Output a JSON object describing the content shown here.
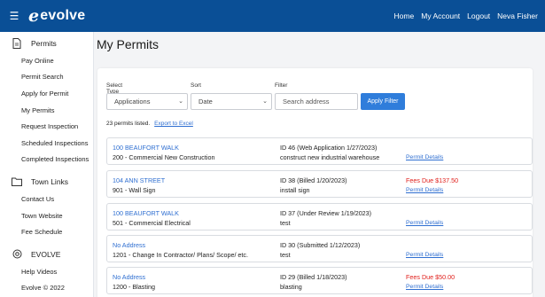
{
  "brand": {
    "name": "evolve",
    "mark": "e"
  },
  "topnav": [
    "Home",
    "My Account",
    "Logout",
    "Neva Fisher"
  ],
  "sidebar": {
    "sections": [
      {
        "title": "Permits",
        "icon": "document-icon",
        "items": [
          "Pay Online",
          "Permit Search",
          "Apply for Permit",
          "My Permits",
          "Request Inspection",
          "Scheduled Inspections",
          "Completed Inspections"
        ]
      },
      {
        "title": "Town Links",
        "icon": "folder-icon",
        "items": [
          "Contact Us",
          "Town Website",
          "Fee Schedule"
        ]
      },
      {
        "title": "EVOLVE",
        "icon": "settings-icon",
        "items": [
          "Help Videos",
          "Evolve © 2022"
        ]
      }
    ]
  },
  "page": {
    "title": "My Permits"
  },
  "filters": {
    "select_type_label": "Select Type",
    "select_type_value": "Applications",
    "sort_label": "Sort",
    "sort_value": "Date",
    "filter_label": "Filter",
    "filter_placeholder": "Search address",
    "apply_label": "Apply Filter"
  },
  "summary": {
    "count_text": "23 permits listed.",
    "export_label": "Export to Excel"
  },
  "permits": [
    {
      "address": "100 BEAUFORT WALK",
      "type": "200 - Commercial New Construction",
      "id": "ID 46 (Web Application 1/27/2023)",
      "description": "construct new industrial warehouse",
      "fees": "",
      "details": "Permit Details"
    },
    {
      "address": "104 ANN STREET",
      "type": "901 - Wall Sign",
      "id": "ID 38 (Billed 1/20/2023)",
      "description": "install sign",
      "fees": "Fees Due $137.50",
      "details": "Permit Details"
    },
    {
      "address": "100 BEAUFORT WALK",
      "type": "501 - Commercial Electrical",
      "id": "ID 37 (Under Review 1/19/2023)",
      "description": "test",
      "fees": "",
      "details": "Permit Details"
    },
    {
      "address": "No Address",
      "type": "1201 - Change In Contractor/ Plans/ Scope/ etc.",
      "id": "ID 30 (Submitted 1/12/2023)",
      "description": "test",
      "fees": "",
      "details": "Permit Details"
    },
    {
      "address": "No Address",
      "type": "1200 - Blasting",
      "id": "ID 29 (Billed 1/18/2023)",
      "description": "blasting",
      "fees": "Fees Due $50.00",
      "details": "Permit Details"
    }
  ],
  "colors": {
    "topbar": "#0a4f96",
    "link": "#2f6fd1",
    "fees": "#e0201c",
    "button": "#2f7ddb"
  }
}
